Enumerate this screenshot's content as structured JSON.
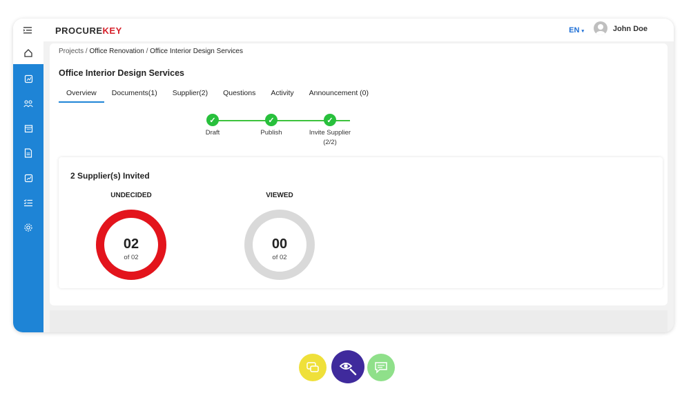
{
  "topbar": {
    "logo_part1": "PROCURE",
    "logo_part2": "KEY",
    "lang": "EN",
    "user_name": "John Doe"
  },
  "breadcrumb": {
    "items": [
      "Projects",
      "Office Renovation",
      "Office Interior Design Services"
    ],
    "separator": "/"
  },
  "page": {
    "title": "Office Interior Design Services",
    "tabs": [
      "Overview",
      "Documents(1)",
      "Supplier(2)",
      "Questions",
      "Activity",
      "Announcement (0)"
    ],
    "active_tab": "Overview"
  },
  "steps": [
    {
      "label": "Draft",
      "sublabel": ""
    },
    {
      "label": "Publish",
      "sublabel": ""
    },
    {
      "label": "Invite Supplier",
      "sublabel": "(2/2)"
    }
  ],
  "suppliers": {
    "title": "2 Supplier(s) Invited",
    "undecided": {
      "label": "UNDECIDED",
      "value": "02",
      "of": "of 02",
      "fraction": 1.0
    },
    "viewed": {
      "label": "VIEWED",
      "value": "00",
      "of": "of 02",
      "fraction": 0.0
    }
  },
  "colors": {
    "sidebar": "#1e84d6",
    "undecided": "#e3141c",
    "ring_empty": "#d9d9d9",
    "step_done": "#28c03c",
    "fab_yellow": "#efe03a",
    "fab_purple": "#3f2a9c",
    "fab_green": "#8fe08a"
  },
  "sidebar_icons": [
    "home-icon",
    "report-icon",
    "users-icon",
    "calendar-icon",
    "document-icon",
    "chart-icon",
    "checklist-icon",
    "settings-icon"
  ],
  "fab_icons": [
    "chat-bubbles-icon",
    "eye-search-icon",
    "message-icon"
  ]
}
